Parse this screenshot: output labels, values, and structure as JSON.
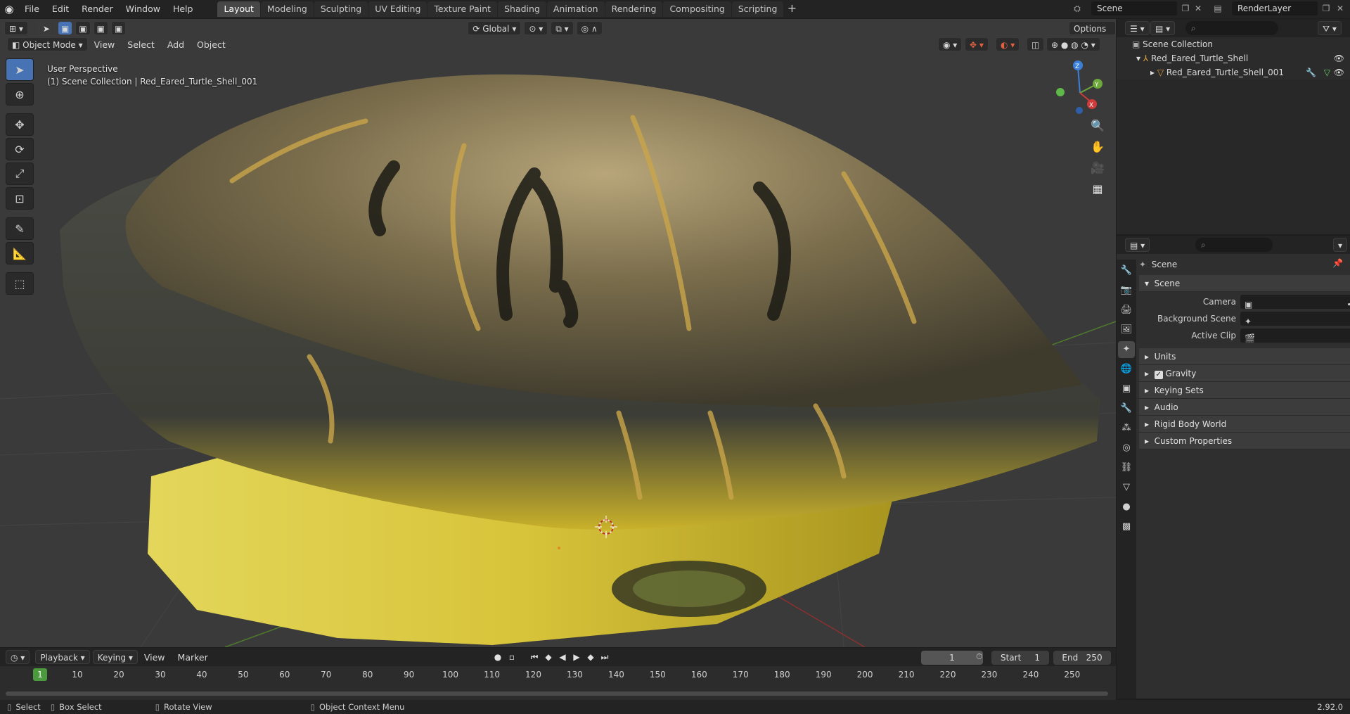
{
  "topbar": {
    "menus": [
      "File",
      "Edit",
      "Render",
      "Window",
      "Help"
    ],
    "workspaces": [
      "Layout",
      "Modeling",
      "Sculpting",
      "UV Editing",
      "Texture Paint",
      "Shading",
      "Animation",
      "Rendering",
      "Compositing",
      "Scripting"
    ],
    "active_workspace": "Layout",
    "scene_name": "Scene",
    "view_layer": "RenderLayer"
  },
  "viewport": {
    "mode": "Object Mode",
    "menus": [
      "View",
      "Select",
      "Add",
      "Object"
    ],
    "transform_orientation": "Global",
    "options_label": "Options",
    "perspective_label": "User Perspective",
    "collection_label": "(1) Scene Collection | Red_Eared_Turtle_Shell_001",
    "gizmo": {
      "x": "X",
      "y": "Y",
      "z": "Z"
    }
  },
  "timeline": {
    "menus": [
      "Playback",
      "Keying",
      "View",
      "Marker"
    ],
    "current_frame": "1",
    "start_label": "Start",
    "start": "1",
    "end_label": "End",
    "end": "250",
    "ruler": [
      "1",
      "10",
      "20",
      "30",
      "40",
      "50",
      "60",
      "70",
      "80",
      "90",
      "100",
      "110",
      "120",
      "130",
      "140",
      "150",
      "160",
      "170",
      "180",
      "190",
      "200",
      "210",
      "220",
      "230",
      "240",
      "250"
    ]
  },
  "statusbar": {
    "select": "Select",
    "box_select": "Box Select",
    "rotate_view": "Rotate View",
    "context_menu": "Object Context Menu",
    "version": "2.92.0"
  },
  "outliner": {
    "root": "Scene Collection",
    "collection": "Red_Eared_Turtle_Shell",
    "object": "Red_Eared_Turtle_Shell_001"
  },
  "properties": {
    "context": "Scene",
    "panel": "Scene",
    "camera_label": "Camera",
    "background_scene_label": "Background Scene",
    "active_clip_label": "Active Clip",
    "subpanels": [
      "Units",
      "Gravity",
      "Keying Sets",
      "Audio",
      "Rigid Body World",
      "Custom Properties"
    ]
  },
  "colors": {
    "accent": "#4772b3",
    "frame_marker": "#4b9a3e",
    "viewport_bg": "#3a3a3a"
  }
}
